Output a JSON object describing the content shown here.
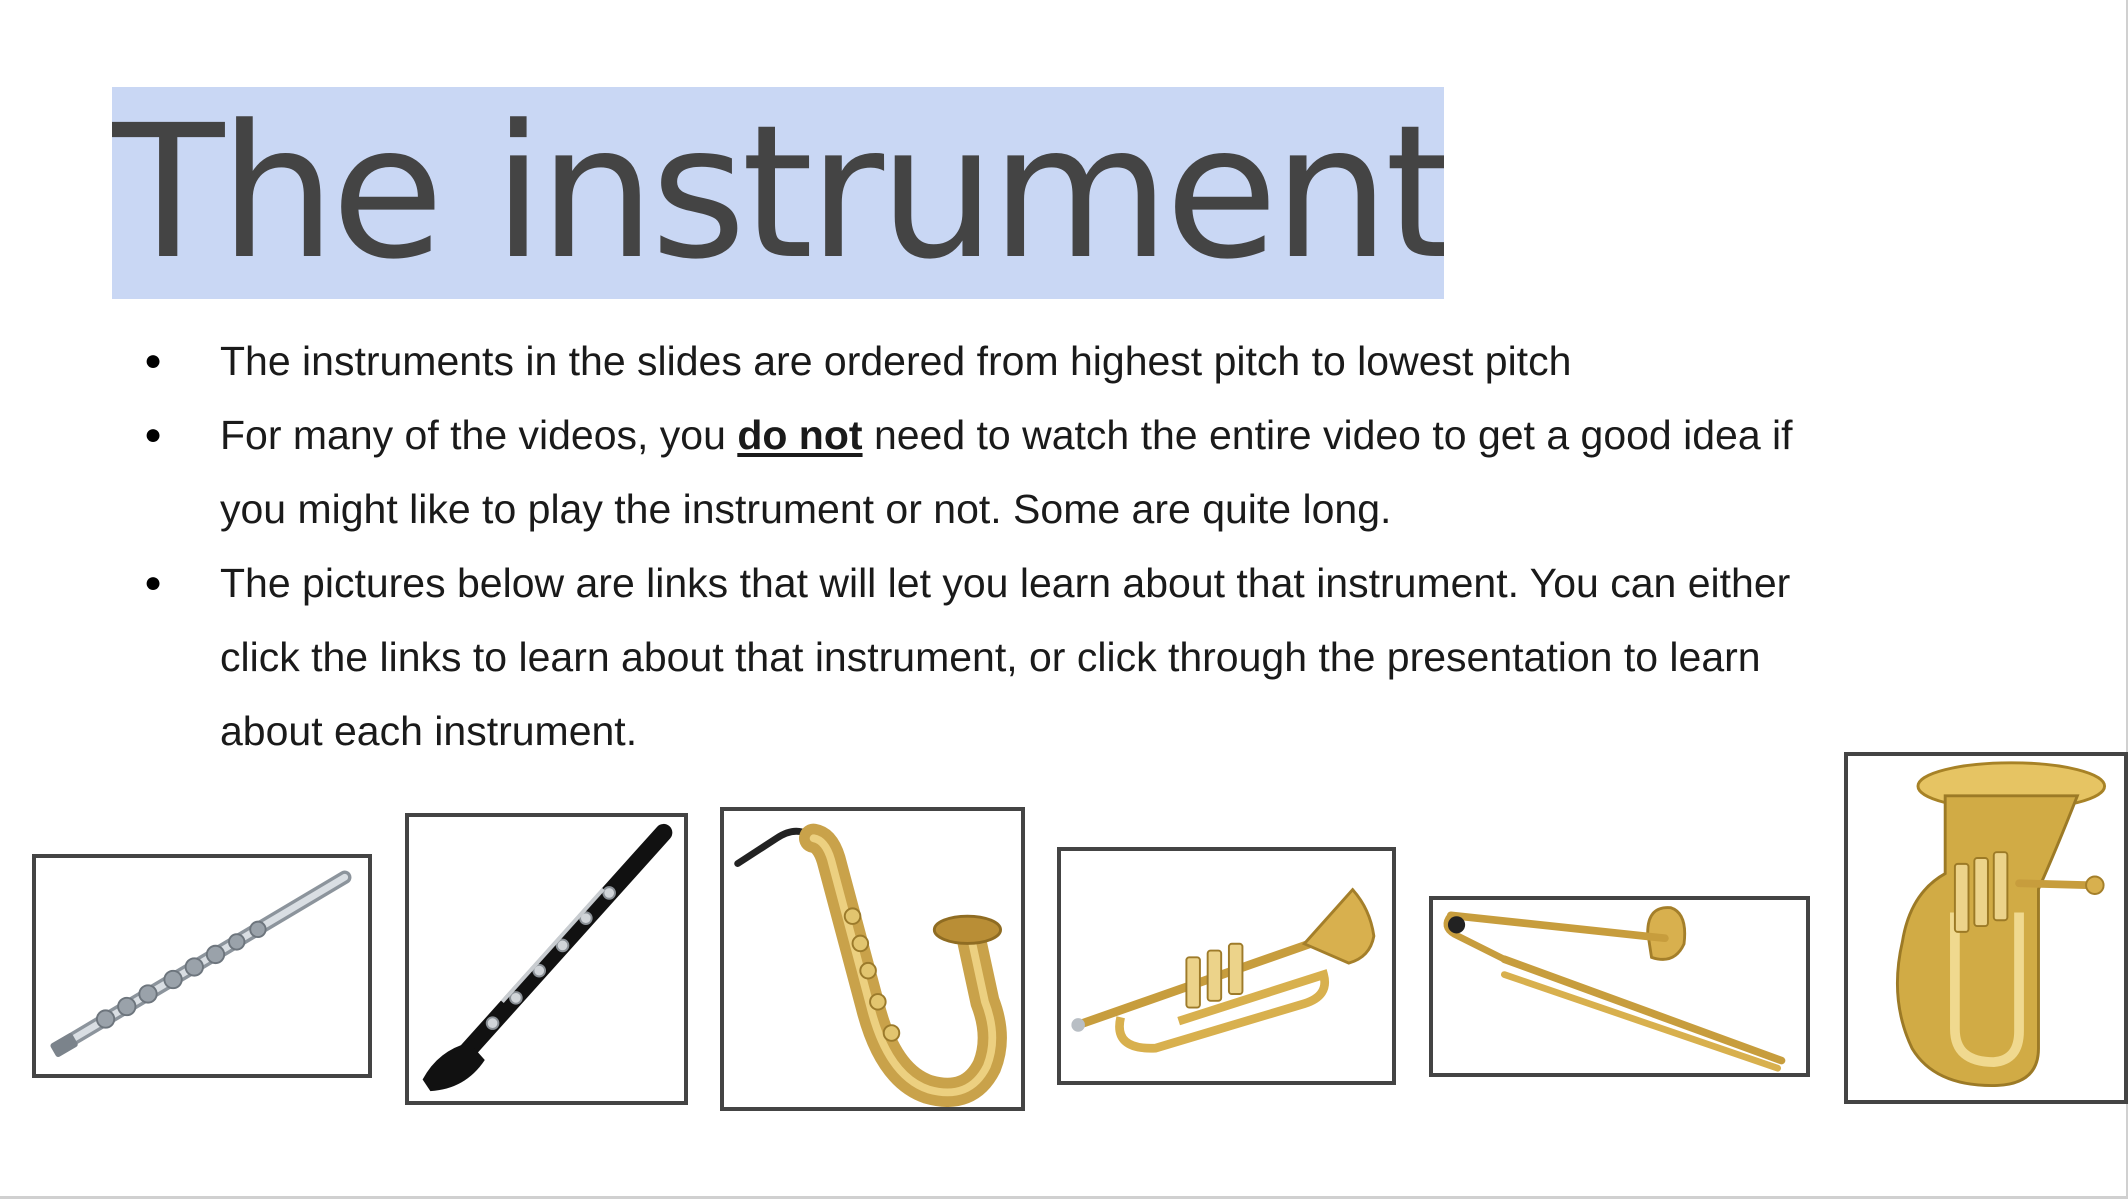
{
  "slide": {
    "title": "The instruments!",
    "bullets": [
      {
        "text": "The instruments in the slides are ordered from highest pitch to lowest pitch"
      },
      {
        "before": "For many of the videos, you ",
        "emphasis": "do not",
        "after": " need to watch the entire video to get a good idea if you might like to play the instrument or not. Some are quite long."
      },
      {
        "text": "The pictures below are links that will let you learn about that instrument. You can either click the links to learn about that instrument, or click through the presentation to learn about each instrument."
      }
    ],
    "bullet_symbol": "●"
  },
  "instruments": [
    {
      "id": "flute",
      "icon": "flute-icon",
      "color": "#b9c0c8"
    },
    {
      "id": "clarinet",
      "icon": "clarinet-icon",
      "color": "#111111"
    },
    {
      "id": "saxophone",
      "icon": "saxophone-icon",
      "color": "#c9a24a"
    },
    {
      "id": "trumpet",
      "icon": "trumpet-icon",
      "color": "#d8b04e"
    },
    {
      "id": "trombone",
      "icon": "trombone-icon",
      "color": "#d8b04e"
    },
    {
      "id": "euphonium",
      "icon": "euphonium-icon",
      "color": "#d1ab45"
    }
  ],
  "colors": {
    "title_highlight": "#c9d7f4",
    "title_text": "#444444",
    "frame_border": "#444444"
  }
}
